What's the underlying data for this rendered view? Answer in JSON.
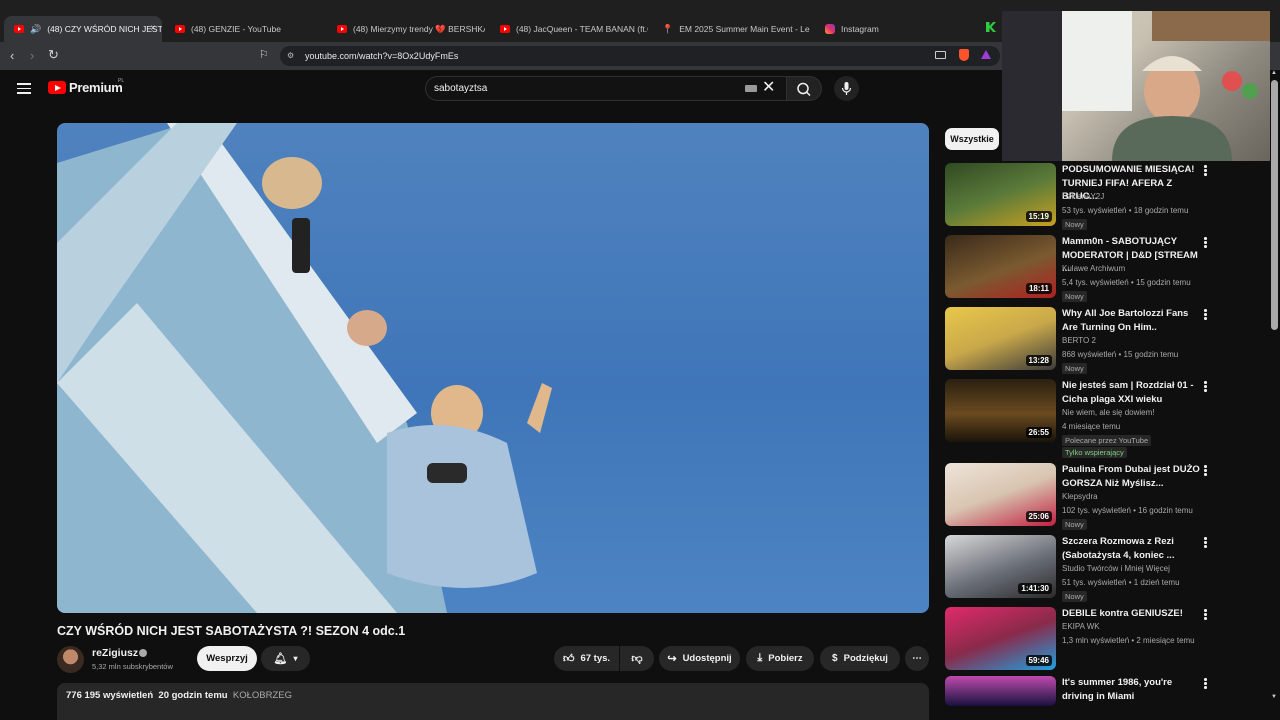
{
  "browser": {
    "tabs": [
      {
        "label": "(48) CZY WŚRÓD NICH JEST",
        "active": true,
        "favicon": "youtube-icon"
      },
      {
        "label": "(48) GENZIE - YouTube",
        "favicon": "youtube-icon"
      },
      {
        "label": "(48) Mierzymy trendy 💔 BERSHKA",
        "favicon": "youtube-icon"
      },
      {
        "label": "(48) JacQueen - TEAM BANAN (ft.Q",
        "favicon": "youtube-icon"
      },
      {
        "label": "EM 2025 Summer Main Event - Leag",
        "favicon": "pin-icon"
      },
      {
        "label": "Instagram",
        "favicon": "instagram-icon"
      }
    ],
    "close_glyph": "×",
    "url": "youtube.com/watch?v=8Ox2UdyFmEs"
  },
  "header": {
    "logo_text": "Premium",
    "logo_region": "PL",
    "search_value": "sabotayztsa"
  },
  "video": {
    "title": "CZY WŚRÓD NICH JEST SABOTAŻYSTA ?! SEZON 4 odc.1",
    "channel": "reZigiusz",
    "subscribers": "5,32 mln subskrybentów",
    "join_label": "Wesprzyj",
    "likes": "67 tys.",
    "share_label": "Udostępnij",
    "download_label": "Pobierz",
    "thanks_label": "Podziękuj",
    "views": "776 195 wyświetleń",
    "posted": "20 godzin temu",
    "location": "KOŁOBRZEG"
  },
  "sidebar": {
    "chip_label": "Wszystkie",
    "items": [
      {
        "title": "PODSUMOWANIE MIESIĄCA! TURNIEJ FIFA! AFERA Z BRUC...",
        "channel": "SzklanaY2J",
        "stats": "53 tys. wyświetleń • 18 godzin temu",
        "badge": "Nowy",
        "duration": "15:19",
        "thumb_color": "#3a5a2a"
      },
      {
        "title": "Mamm0n - SABOTUJĄCY MODERATOR | D&D [STREAM ...",
        "channel": "Kulawe Archiwum",
        "stats": "5,4 tys. wyświetleń • 15 godzin temu",
        "badge": "Nowy",
        "duration": "18:11",
        "thumb_color": "#5a3a22"
      },
      {
        "title": "Why All Joe Bartolozzi Fans Are Turning On Him..",
        "channel": "BERTO 2",
        "stats": "868 wyświetleń • 15 godzin temu",
        "badge": "Nowy",
        "duration": "13:28",
        "thumb_color": "#c9a84a"
      },
      {
        "title": "Nie jesteś sam | Rozdział 01 - Cicha plaga XXI wieku",
        "channel": "Nie wiem, ale się dowiem!",
        "stats": "4 miesiące temu",
        "badge": "Polecane przez YouTube",
        "badge2": "Tylko wspierający",
        "duration": "26:55",
        "thumb_color": "#3a2c18"
      },
      {
        "title": "Paulina From Dubai jest DUŻO GORSZA Niż Myślisz...",
        "channel": "Klepsydra",
        "stats": "102 tys. wyświetleń • 16 godzin temu",
        "badge": "Nowy",
        "duration": "25:06",
        "thumb_color": "#d8c4b0"
      },
      {
        "title": "Szczera Rozmowa z Rezi (Sabotażysta 4, koniec ...",
        "channel": "Studio Twórców i Mniej Więcej",
        "stats": "51 tys. wyświetleń • 1 dzień temu",
        "badge": "Nowy",
        "duration": "1:41:30",
        "thumb_color": "#6a6f78"
      },
      {
        "title": "DEBILE kontra GENIUSZE!",
        "channel": "EKIPA WK",
        "stats": "1,3 mln wyświetleń • 2 miesiące temu",
        "duration": "59:46",
        "thumb_color": "#8a2a4a"
      },
      {
        "title": "It's summer 1986, you're driving in Miami",
        "channel": "",
        "stats": "",
        "thumb_color": "#5a2a6a"
      }
    ]
  },
  "colors": {
    "accent": "#ff0000",
    "background": "#0f0f0f",
    "pill": "#272727"
  }
}
